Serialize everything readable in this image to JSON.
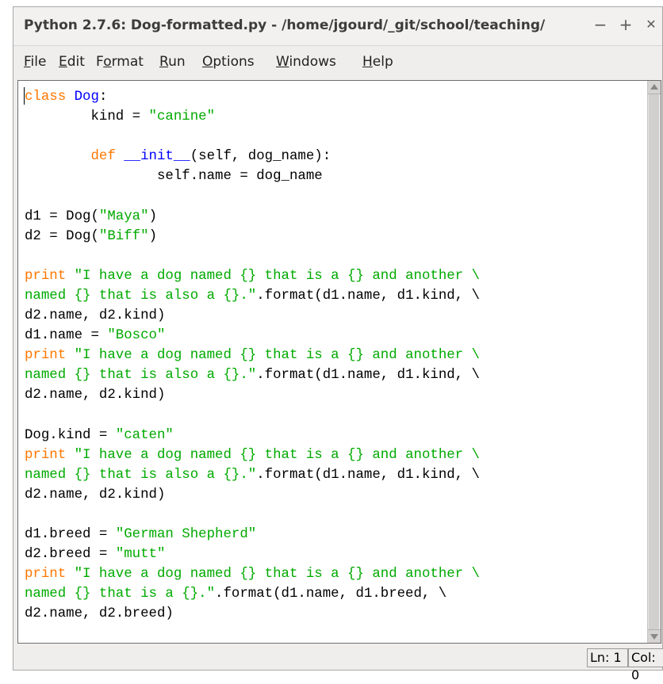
{
  "window": {
    "title": "Python 2.7.6: Dog-formatted.py - /home/jgourd/_git/school/teaching/",
    "minimize_glyph": "−",
    "maximize_glyph": "+",
    "close_glyph": "✕"
  },
  "menu": [
    {
      "underline": "F",
      "rest": "ile"
    },
    {
      "underline": "E",
      "rest": "dit"
    },
    {
      "pre": "F",
      "underline": "o",
      "rest": "rmat"
    },
    {
      "underline": "R",
      "rest": "un"
    },
    {
      "underline": "O",
      "rest": "ptions"
    },
    {
      "underline": "W",
      "rest": "indows"
    },
    {
      "underline": "H",
      "rest": "elp"
    }
  ],
  "code_lines": [
    [
      {
        "t": "class",
        "c": "kw"
      },
      {
        "t": " "
      },
      {
        "t": "Dog",
        "c": "def"
      },
      {
        "t": ":"
      }
    ],
    [
      {
        "t": "        kind = "
      },
      {
        "t": "\"canine\"",
        "c": "str"
      }
    ],
    [
      {
        "t": ""
      }
    ],
    [
      {
        "t": "        "
      },
      {
        "t": "def",
        "c": "kw"
      },
      {
        "t": " "
      },
      {
        "t": "__init__",
        "c": "def"
      },
      {
        "t": "(self, dog_name):"
      }
    ],
    [
      {
        "t": "                self.name = dog_name"
      }
    ],
    [
      {
        "t": ""
      }
    ],
    [
      {
        "t": "d1 = Dog("
      },
      {
        "t": "\"Maya\"",
        "c": "str"
      },
      {
        "t": ")"
      }
    ],
    [
      {
        "t": "d2 = Dog("
      },
      {
        "t": "\"Biff\"",
        "c": "str"
      },
      {
        "t": ")"
      }
    ],
    [
      {
        "t": ""
      }
    ],
    [
      {
        "t": "print",
        "c": "kw"
      },
      {
        "t": " "
      },
      {
        "t": "\"I have a dog named {} that is a {} and another \\",
        "c": "str"
      }
    ],
    [
      {
        "t": "named {} that is also a {}.\"",
        "c": "str"
      },
      {
        "t": ".format(d1.name, d1.kind, \\"
      }
    ],
    [
      {
        "t": "d2.name, d2.kind)"
      }
    ],
    [
      {
        "t": "d1.name = "
      },
      {
        "t": "\"Bosco\"",
        "c": "str"
      }
    ],
    [
      {
        "t": "print",
        "c": "kw"
      },
      {
        "t": " "
      },
      {
        "t": "\"I have a dog named {} that is a {} and another \\",
        "c": "str"
      }
    ],
    [
      {
        "t": "named {} that is also a {}.\"",
        "c": "str"
      },
      {
        "t": ".format(d1.name, d1.kind, \\"
      }
    ],
    [
      {
        "t": "d2.name, d2.kind)"
      }
    ],
    [
      {
        "t": ""
      }
    ],
    [
      {
        "t": "Dog.kind = "
      },
      {
        "t": "\"caten\"",
        "c": "str"
      }
    ],
    [
      {
        "t": "print",
        "c": "kw"
      },
      {
        "t": " "
      },
      {
        "t": "\"I have a dog named {} that is a {} and another \\",
        "c": "str"
      }
    ],
    [
      {
        "t": "named {} that is also a {}.\"",
        "c": "str"
      },
      {
        "t": ".format(d1.name, d1.kind, \\"
      }
    ],
    [
      {
        "t": "d2.name, d2.kind)"
      }
    ],
    [
      {
        "t": ""
      }
    ],
    [
      {
        "t": "d1.breed = "
      },
      {
        "t": "\"German Shepherd\"",
        "c": "str"
      }
    ],
    [
      {
        "t": "d2.breed = "
      },
      {
        "t": "\"mutt\"",
        "c": "str"
      }
    ],
    [
      {
        "t": "print",
        "c": "kw"
      },
      {
        "t": " "
      },
      {
        "t": "\"I have a dog named {} that is a {} and another \\",
        "c": "str"
      }
    ],
    [
      {
        "t": "named {} that is a {}.\"",
        "c": "str"
      },
      {
        "t": ".format(d1.name, d1.breed, \\"
      }
    ],
    [
      {
        "t": "d2.name, d2.breed)"
      }
    ]
  ],
  "status": {
    "line": "Ln: 1",
    "col": "Col: 0"
  },
  "colors": {
    "keyword": "#ff7700",
    "definition": "#0000ff",
    "string": "#00aa00"
  }
}
